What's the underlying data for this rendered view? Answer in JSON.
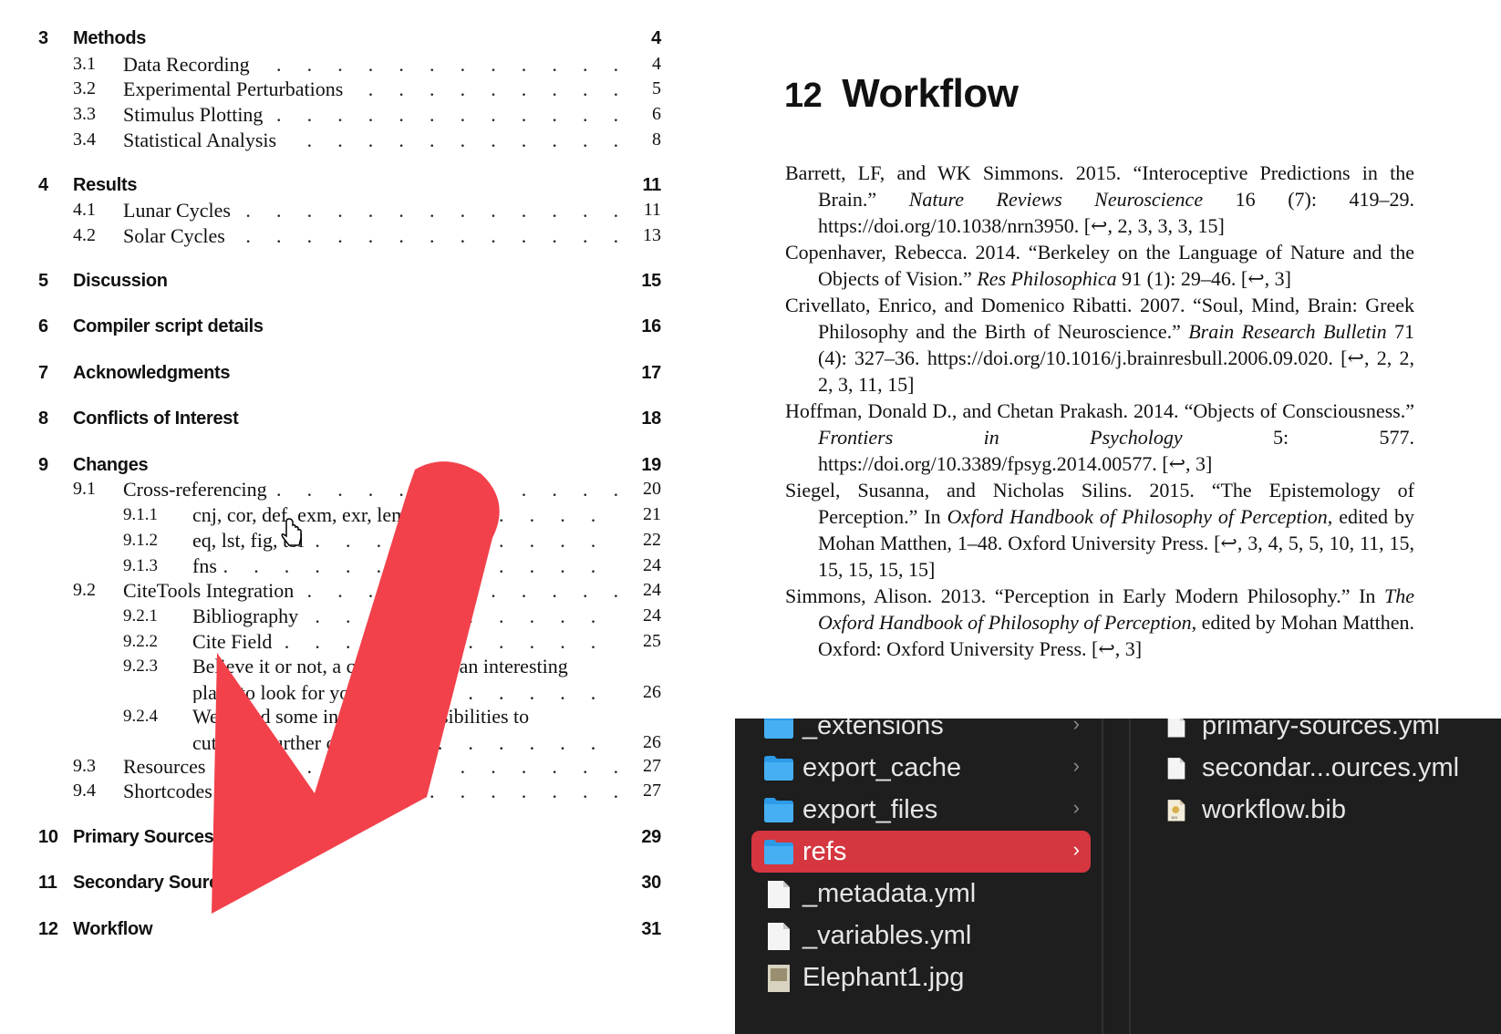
{
  "toc": {
    "chapters": [
      {
        "num": "3",
        "title": "Methods",
        "page": "4",
        "sections": [
          {
            "num": "3.1",
            "title": "Data Recording",
            "page": "4"
          },
          {
            "num": "3.2",
            "title": "Experimental Perturbations",
            "page": "5"
          },
          {
            "num": "3.3",
            "title": "Stimulus Plotting",
            "page": "6"
          },
          {
            "num": "3.4",
            "title": "Statistical Analysis",
            "page": "8"
          }
        ]
      },
      {
        "num": "4",
        "title": "Results",
        "page": "11",
        "sections": [
          {
            "num": "4.1",
            "title": "Lunar Cycles",
            "page": "11"
          },
          {
            "num": "4.2",
            "title": "Solar Cycles",
            "page": "13"
          }
        ]
      },
      {
        "num": "5",
        "title": "Discussion",
        "page": "15"
      },
      {
        "num": "6",
        "title": "Compiler script details",
        "page": "16"
      },
      {
        "num": "7",
        "title": "Acknowledgments",
        "page": "17"
      },
      {
        "num": "8",
        "title": "Conflicts of Interest",
        "page": "18"
      },
      {
        "num": "9",
        "title": "Changes",
        "page": "19",
        "sections": [
          {
            "num": "9.1",
            "title": "Cross-referencing",
            "page": "20"
          },
          {
            "num": "9.1.1",
            "title": "cnj, cor, def, exm, exr, lem, thm",
            "page": "21"
          },
          {
            "num": "9.1.2",
            "title": "eq, lst, fig, tbl",
            "page": "22"
          },
          {
            "num": "9.1.3",
            "title": "fns",
            "page": "24"
          },
          {
            "num": "9.2",
            "title": "CiteTools Integration",
            "page": "24"
          },
          {
            "num": "9.2.1",
            "title": "Bibliography",
            "page": "24"
          },
          {
            "num": "9.2.2",
            "title": "Cite Field",
            "page": "25"
          },
          {
            "num": "9.2.3",
            "title": "Believe it or not, a corner can be an interesting",
            "title2": "place to look for your...",
            "page": "26"
          },
          {
            "num": "9.2.4",
            "title": "We found some interesting possibilities to",
            "title2": "cut it for further control...",
            "page": "26"
          },
          {
            "num": "9.3",
            "title": "Resources",
            "page": "27"
          },
          {
            "num": "9.4",
            "title": "Shortcodes",
            "page": "27"
          }
        ]
      },
      {
        "num": "10",
        "title": "Primary Sources",
        "page": "29"
      },
      {
        "num": "11",
        "title": "Secondary Sources",
        "page": "30"
      },
      {
        "num": "12",
        "title": "Workflow",
        "page": "31"
      }
    ]
  },
  "document": {
    "chapter_num": "12",
    "chapter_title": "Workflow",
    "references": [
      {
        "pre": "Barrett, LF, and WK Simmons. 2015. “Interoceptive Predictions in the Brain.” ",
        "journal": "Nature Reviews Neuroscience",
        "post": " 16 (7): 419–29. https://doi.org/10.1038/nrn3950. [↩, 2, 3, 3, 3, 15]"
      },
      {
        "pre": "Copenhaver, Rebecca. 2014. “Berkeley on the Language of Nature and the Objects of Vision.” ",
        "journal": "Res Philosophica",
        "post": " 91 (1): 29–46. [↩, 3]"
      },
      {
        "pre": "Crivellato, Enrico, and Domenico Ribatti. 2007. “Soul, Mind, Brain: Greek Philosophy and the Birth of Neuroscience.” ",
        "journal": "Brain Research Bulletin",
        "post": " 71 (4): 327–36. https://doi.org/10.1016/j.brainresbull.2006.09.020. [↩, 2, 2, 2, 3, 11, 15]"
      },
      {
        "pre": "Hoffman, Donald D., and Chetan Prakash. 2014. “Objects of Consciousness.” ",
        "journal": "Frontiers in Psychology",
        "post": " 5: 577. https://doi.org/10.3389/fpsyg.2014.00577. [↩, 3]"
      },
      {
        "pre": "Siegel, Susanna, and Nicholas Silins. 2015. “The Epistemology of Perception.” In ",
        "journal": "Oxford Handbook of Philosophy of Perception",
        "post": ", edited by Mohan Matthen, 1–48. Oxford University Press. [↩, 3, 4, 5, 5, 10, 11, 15, 15, 15, 15, 15]"
      },
      {
        "pre": "Simmons, Alison. 2013. “Perception in Early Modern Philosophy.” In ",
        "journal": "The Oxford Handbook of Philosophy of Perception",
        "post": ", edited by Mohan Matthen. Oxford: Oxford University Press. [↩, 3]"
      }
    ]
  },
  "finder": {
    "folder_color": "#2d9ae8",
    "selected_color": "#d53640",
    "column1": [
      {
        "name": "_extensions",
        "type": "folder",
        "chevron": "›"
      },
      {
        "name": "export_cache",
        "type": "folder",
        "chevron": "›"
      },
      {
        "name": "export_files",
        "type": "folder",
        "chevron": "›"
      },
      {
        "name": "refs",
        "type": "folder",
        "chevron": "›",
        "selected": true
      },
      {
        "name": "_metadata.yml",
        "type": "file"
      },
      {
        "name": "_variables.yml",
        "type": "file"
      },
      {
        "name": "Elephant1.jpg",
        "type": "image"
      }
    ],
    "column2": [
      {
        "name": "primary-sources.yml",
        "type": "file"
      },
      {
        "name": "secondar...ources.yml",
        "type": "file"
      },
      {
        "name": "workflow.bib",
        "type": "bib"
      }
    ]
  },
  "overlay": {
    "arrow_color": "#f2414b",
    "cursor": "hand-pointer-icon"
  }
}
